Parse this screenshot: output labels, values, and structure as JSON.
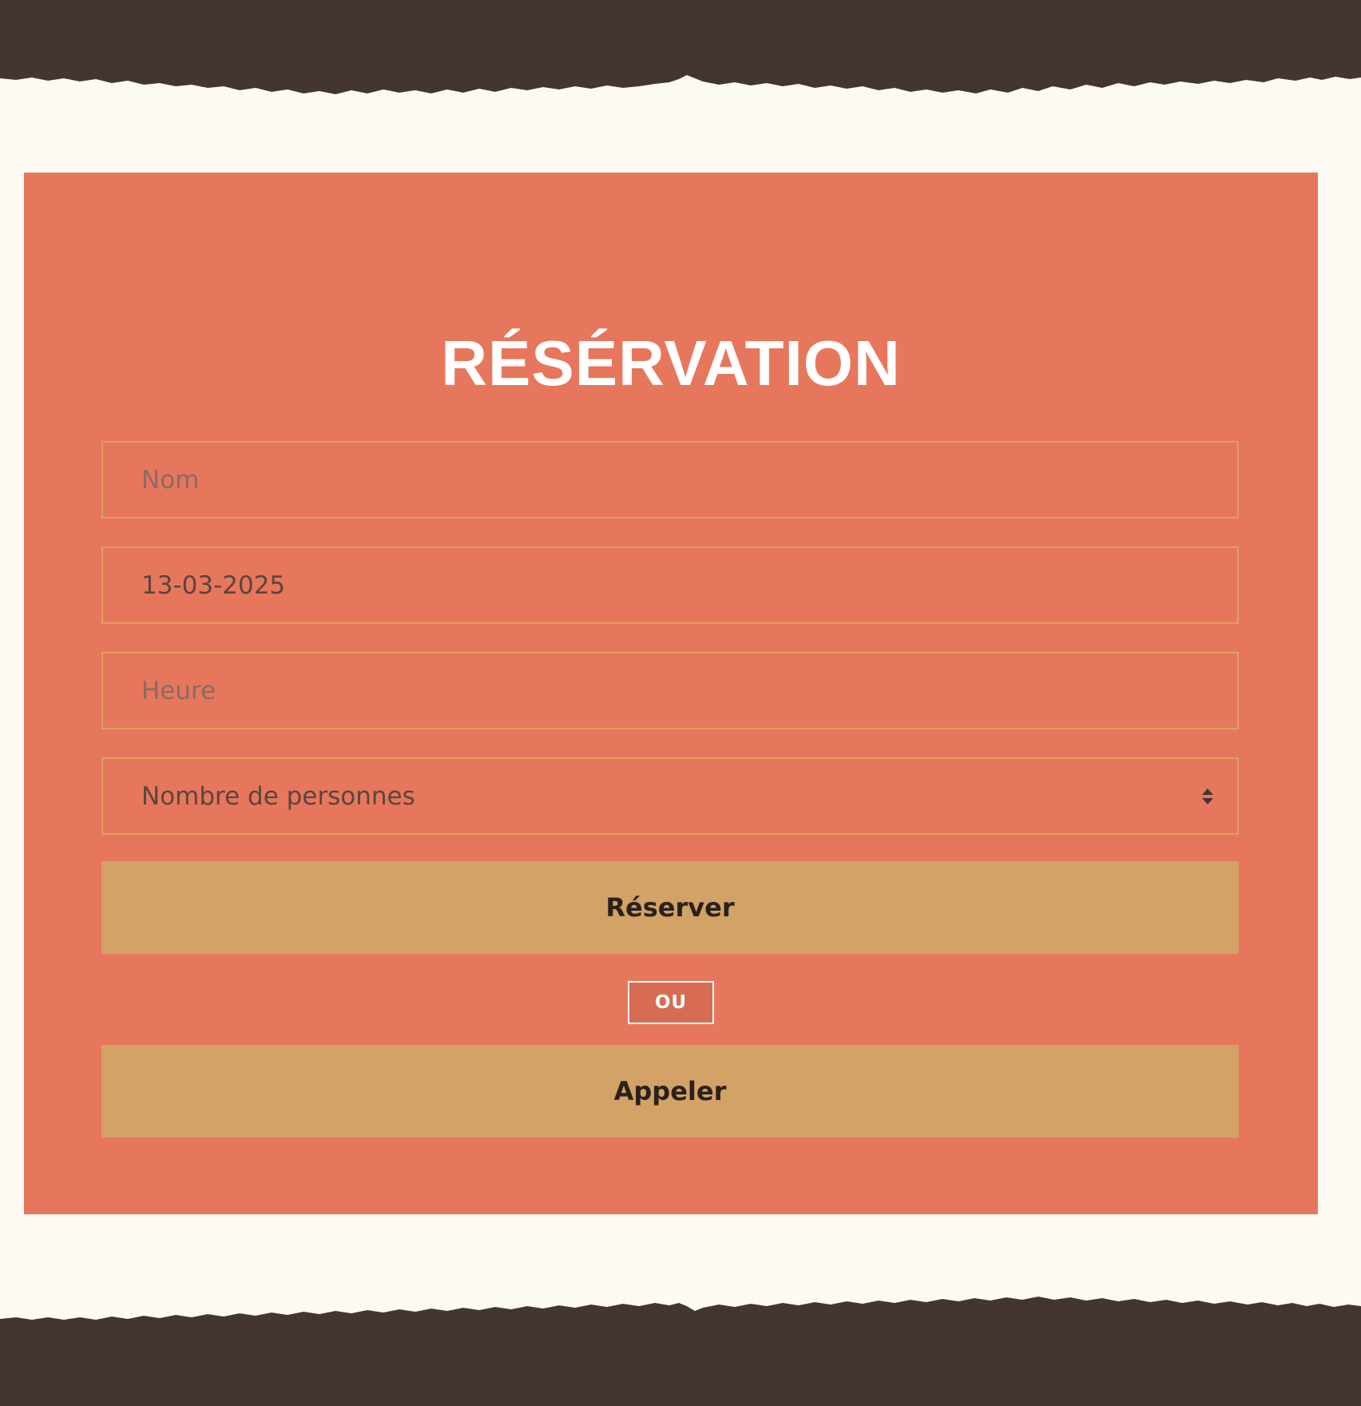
{
  "colors": {
    "dark_band": "#433532",
    "page_background": "#fdfaf3",
    "panel": "#e7775c",
    "field_border": "#d9a35f",
    "button": "#d2a266",
    "button_text": "#2a211d",
    "title": "#ffffff"
  },
  "reservation": {
    "title": "RÉSÉRVATION",
    "fields": {
      "nom_placeholder": "Nom",
      "date_value": "13-03-2025",
      "heure_placeholder": "Heure",
      "personnes_selected": "Nombre de personnes"
    },
    "reserve_label": "Réserver",
    "separator": "OU",
    "call_label": "Appeler"
  }
}
